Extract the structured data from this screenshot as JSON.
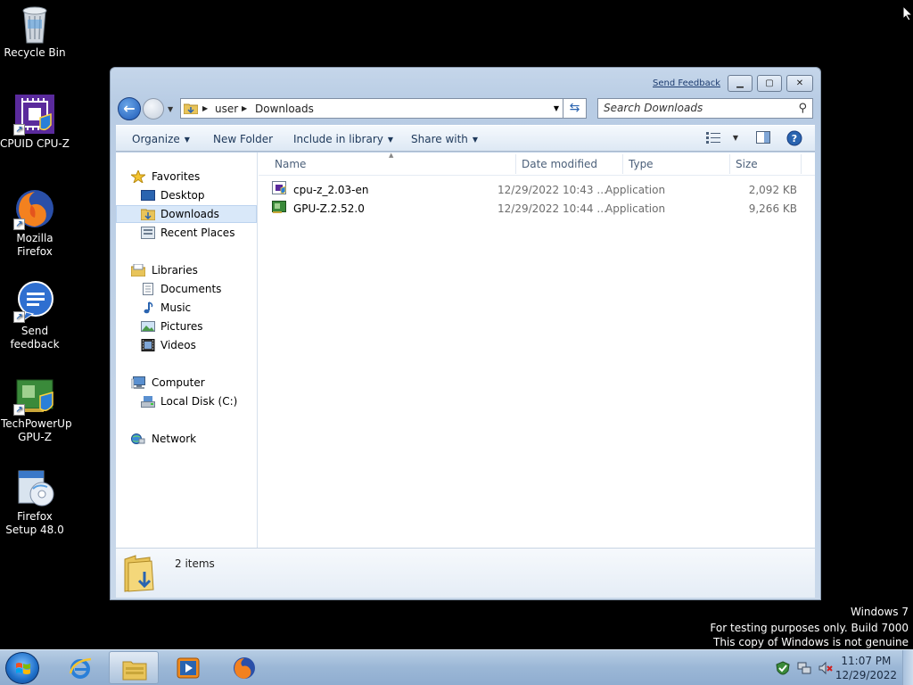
{
  "desktop": {
    "icons": [
      {
        "label": "Recycle Bin",
        "icon": "recycle-bin-icon"
      },
      {
        "label": "CPUID CPU-Z",
        "icon": "cpu-z-icon"
      },
      {
        "label": "Mozilla Firefox",
        "icon": "firefox-icon"
      },
      {
        "label": "Send feedback",
        "icon": "feedback-icon"
      },
      {
        "label": "TechPowerUp GPU-Z",
        "icon": "gpu-z-icon"
      },
      {
        "label": "Firefox Setup 48.0",
        "icon": "setup-icon"
      }
    ]
  },
  "window": {
    "send_feedback": "Send Feedback",
    "address": {
      "crumbs": [
        "user",
        "Downloads"
      ]
    },
    "search": {
      "placeholder": "Search Downloads"
    },
    "toolbar": {
      "organize": "Organize",
      "new_folder": "New Folder",
      "include_in_library": "Include in library",
      "share_with": "Share with"
    },
    "nav": {
      "favorites": "Favorites",
      "desktop": "Desktop",
      "downloads": "Downloads",
      "recent_places": "Recent Places",
      "libraries": "Libraries",
      "documents": "Documents",
      "music": "Music",
      "pictures": "Pictures",
      "videos": "Videos",
      "computer": "Computer",
      "local_disk": "Local Disk (C:)",
      "network": "Network"
    },
    "columns": {
      "name": "Name",
      "date_modified": "Date modified",
      "type": "Type",
      "size": "Size"
    },
    "files": [
      {
        "name": "cpu-z_2.03-en",
        "date": "12/29/2022 10:43 ...",
        "type": "Application",
        "size": "2,092 KB"
      },
      {
        "name": "GPU-Z.2.52.0",
        "date": "12/29/2022 10:44 ...",
        "type": "Application",
        "size": "9,266 KB"
      }
    ],
    "details": {
      "count": "2 items"
    }
  },
  "watermark": {
    "line1": "Windows 7",
    "line2": "For testing purposes only. Build 7000",
    "line3": "This copy of Windows is not genuine"
  },
  "taskbar": {
    "time": "11:07 PM",
    "date": "12/29/2022"
  }
}
